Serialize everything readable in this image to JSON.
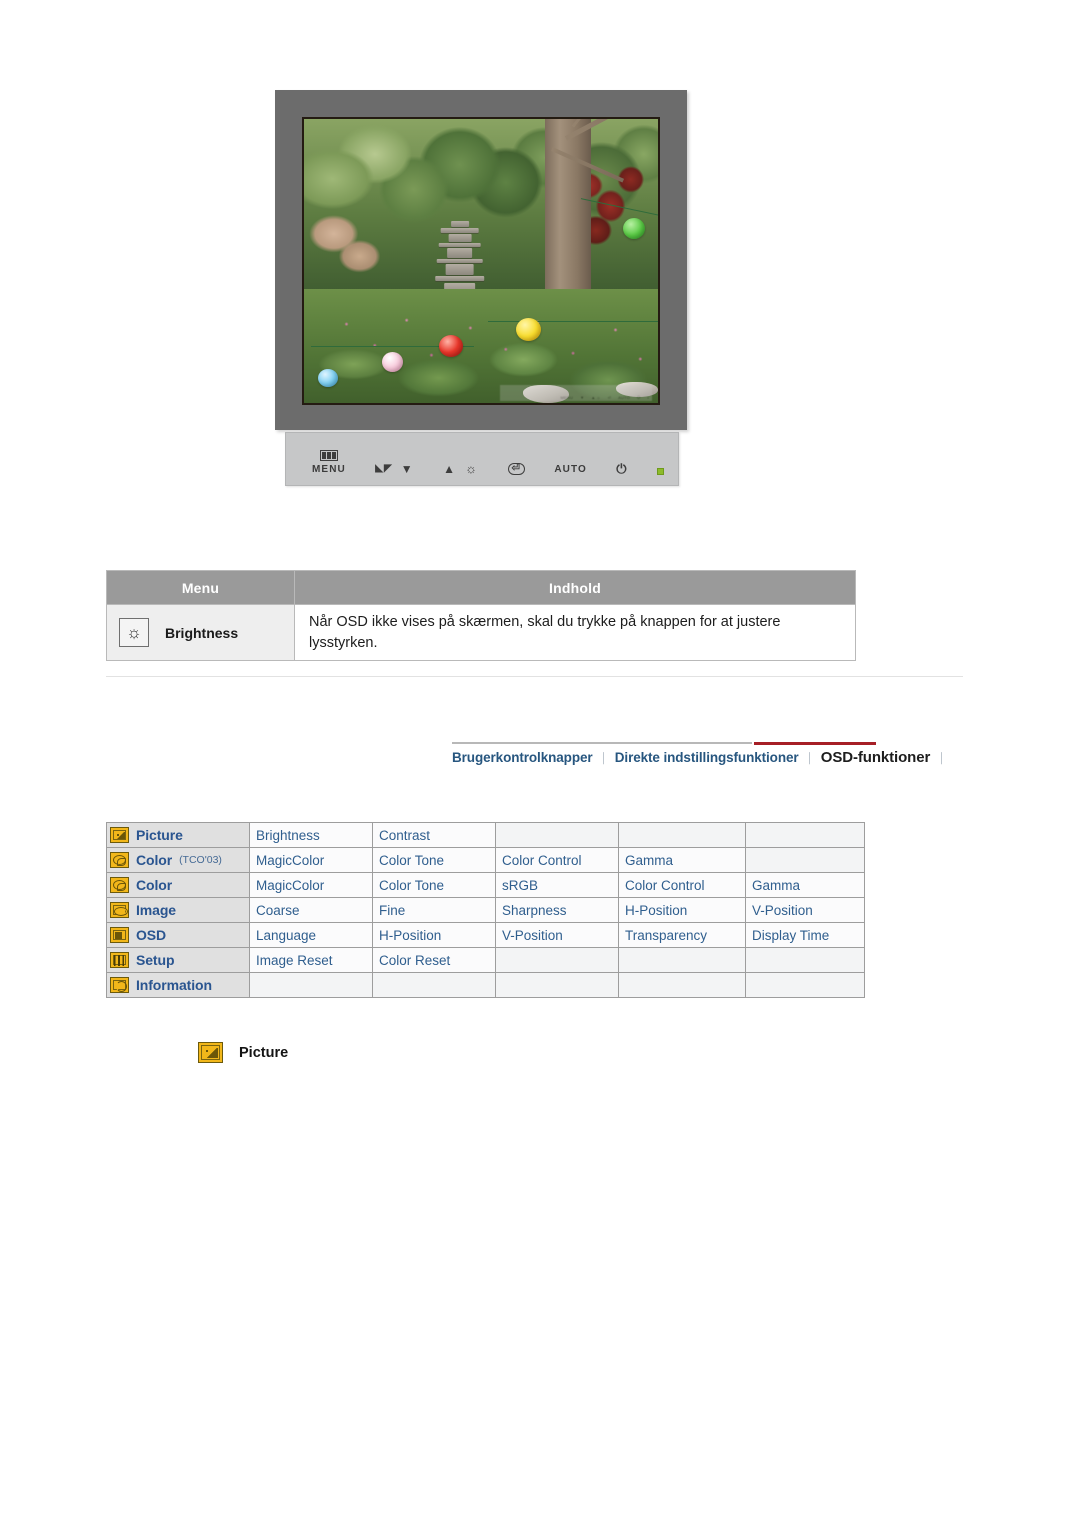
{
  "monitor": {
    "alt": "LCD monitor displaying garden photo with stone pagoda and paper lanterns",
    "screen_scene": "korean-garden-pagoda-lanterns",
    "control_panel": {
      "buttons": [
        {
          "name": "menu",
          "label": "MENU",
          "icon": "menu-bars-icon"
        },
        {
          "name": "magicbright-down",
          "label": "",
          "icon": "magicbright-down-icon"
        },
        {
          "name": "brightness-up",
          "label": "",
          "icon": "brightness-up-icon"
        },
        {
          "name": "enter",
          "label": "",
          "icon": "enter-icon"
        },
        {
          "name": "auto",
          "label": "AUTO",
          "icon": ""
        },
        {
          "name": "power",
          "label": "",
          "icon": "power-icon"
        },
        {
          "name": "power-indicator",
          "label": "",
          "icon": "power-led"
        }
      ],
      "glyphs": {
        "magicbright": "◣◤",
        "down": "▼",
        "up": "▲",
        "brightness": "☼",
        "enter": "⏎",
        "power": "⏻"
      },
      "led_color": "#8dbb2a"
    },
    "screen_echo_labels": [
      "MENU",
      "▼",
      "▲ ☼",
      "⏎",
      "AUTO",
      "⏻",
      "•"
    ]
  },
  "brightness_table": {
    "headers": {
      "menu": "Menu",
      "content": "Indhold"
    },
    "row": {
      "icon": "brightness-sun-icon",
      "icon_glyph": "☼",
      "menu_label": "Brightness",
      "content": "Når OSD ikke vises på skærmen, skal du trykke på knappen for at justere lysstyrken."
    },
    "header_bg": "#9a9a9a",
    "menu_cell_bg": "#eeeeee"
  },
  "nav": {
    "items": [
      {
        "label": "Brugerkontrolknapper",
        "active": false
      },
      {
        "label": "Direkte indstillingsfunktioner",
        "active": false
      },
      {
        "label": "OSD-funktioner",
        "active": true
      }
    ],
    "separator": "⏐",
    "accent_color": "#a61f26",
    "link_color": "#27567f"
  },
  "osd_matrix": {
    "rows": [
      {
        "icon": "picture-icon",
        "icon_class": "ic-picture",
        "label": "Picture",
        "sub": "",
        "items": [
          "Brightness",
          "Contrast",
          "",
          "",
          ""
        ]
      },
      {
        "icon": "color-icon",
        "icon_class": "ic-color",
        "label": "Color",
        "sub": "(TCO'03)",
        "items": [
          "MagicColor",
          "Color Tone",
          "Color Control",
          "Gamma",
          ""
        ]
      },
      {
        "icon": "color-icon",
        "icon_class": "ic-color",
        "label": "Color",
        "sub": "",
        "items": [
          "MagicColor",
          "Color Tone",
          "sRGB",
          "Color Control",
          "Gamma"
        ]
      },
      {
        "icon": "image-icon",
        "icon_class": "ic-image",
        "label": "Image",
        "sub": "",
        "items": [
          "Coarse",
          "Fine",
          "Sharpness",
          "H-Position",
          "V-Position"
        ]
      },
      {
        "icon": "osd-icon",
        "icon_class": "ic-osd",
        "label": "OSD",
        "sub": "",
        "items": [
          "Language",
          "H-Position",
          "V-Position",
          "Transparency",
          "Display Time"
        ]
      },
      {
        "icon": "setup-icon",
        "icon_class": "ic-setup",
        "label": "Setup",
        "sub": "",
        "items": [
          "Image Reset",
          "Color Reset",
          "",
          "",
          ""
        ]
      },
      {
        "icon": "information-icon",
        "icon_class": "ic-info",
        "label": "Information",
        "sub": "",
        "items": [
          "",
          "",
          "",
          "",
          ""
        ]
      }
    ],
    "label_text_color": "#2a5590",
    "item_text_color": "#2f5e8e",
    "icon_color": "#f2b71a"
  },
  "picture_caption": {
    "icon": "picture-icon",
    "label": "Picture"
  }
}
